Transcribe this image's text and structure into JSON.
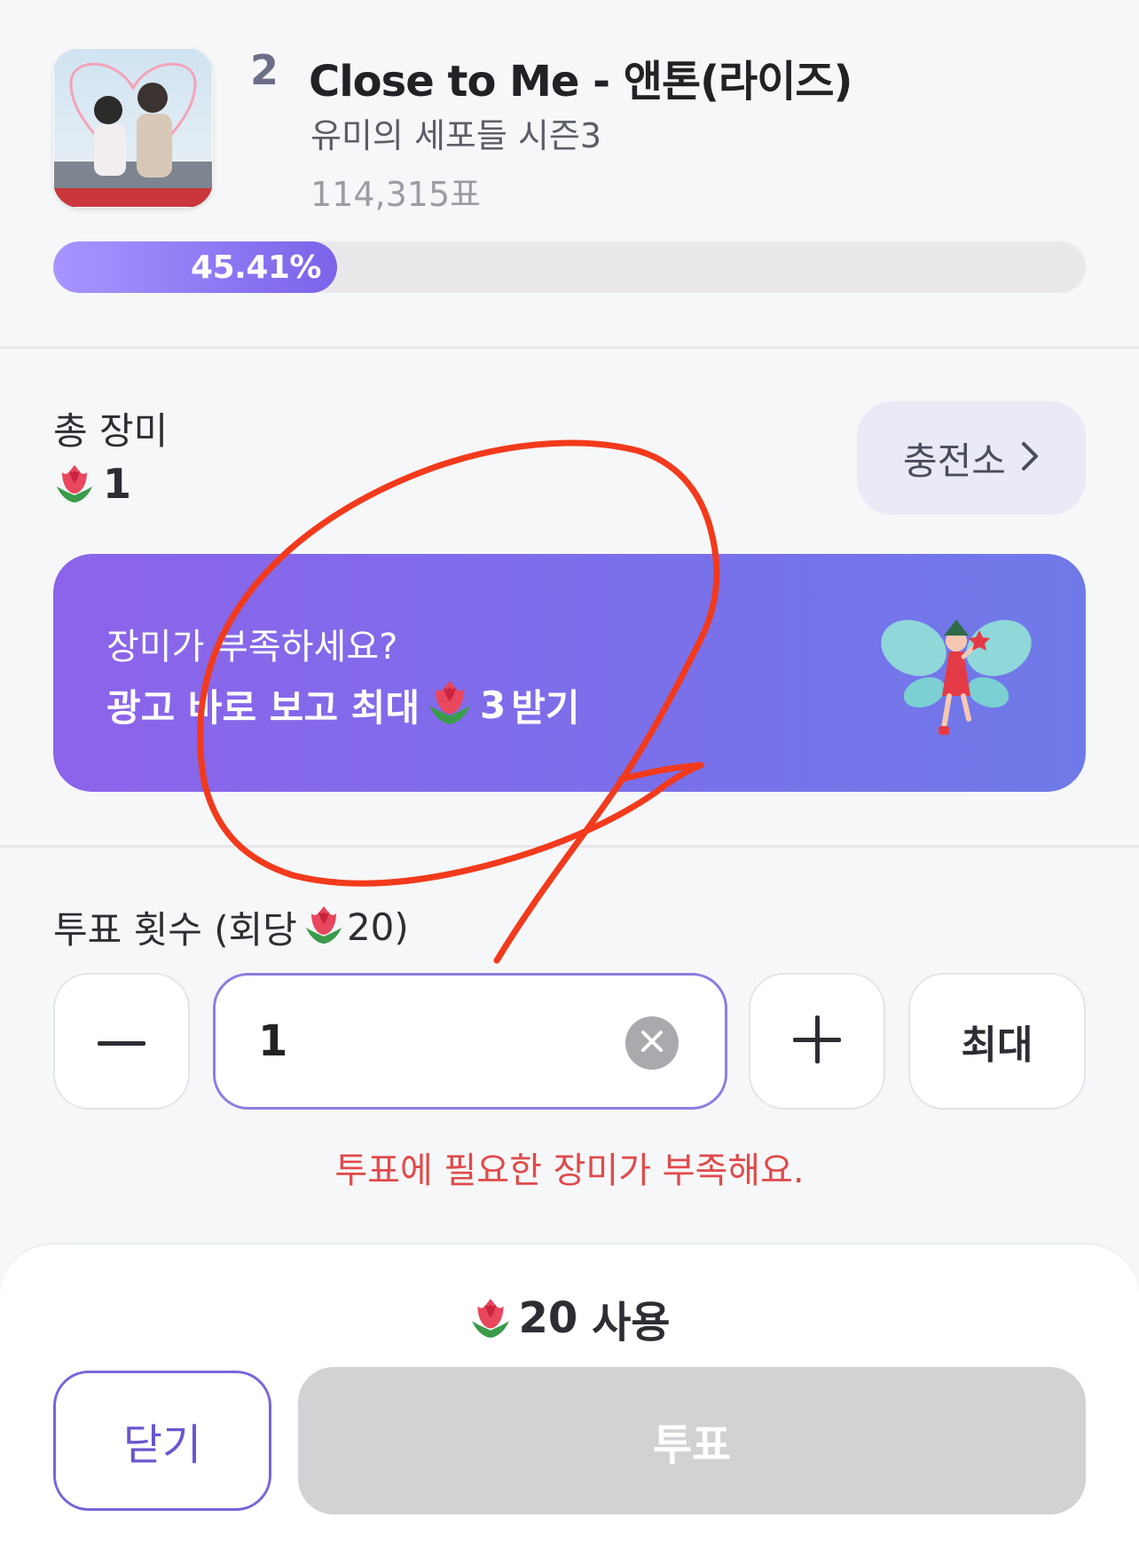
{
  "song": {
    "rank": "2",
    "title": "Close to Me - 앤톤(라이즈)",
    "program": "유미의 세포들 시즌3",
    "votes": "114,315표",
    "percent_label": "45.41%",
    "percent_value": 45.41
  },
  "roses": {
    "total_label": "총 장미",
    "total_value": "1",
    "charge_label": "충전소"
  },
  "ad": {
    "line1": "장미가 부족하세요?",
    "line2_prefix": "광고 바로 보고 최대",
    "line2_amount": "3",
    "line2_suffix": "받기"
  },
  "vote": {
    "label_prefix": "투표 횟수 (회당",
    "label_cost": "20)",
    "count_value": "1",
    "max_label": "최대",
    "error": "투표에 필요한 장미가 부족해요."
  },
  "bottom": {
    "use_amount": "20",
    "use_suffix": "사용",
    "close_label": "닫기",
    "vote_label": "투표"
  },
  "colors": {
    "accent": "#7c63ea",
    "error": "#e04a4a",
    "annotation": "#f23a1c"
  },
  "icons": [
    "rose-icon",
    "chevron-right-icon",
    "minus-icon",
    "plus-icon",
    "clear-icon",
    "fairy-icon"
  ]
}
